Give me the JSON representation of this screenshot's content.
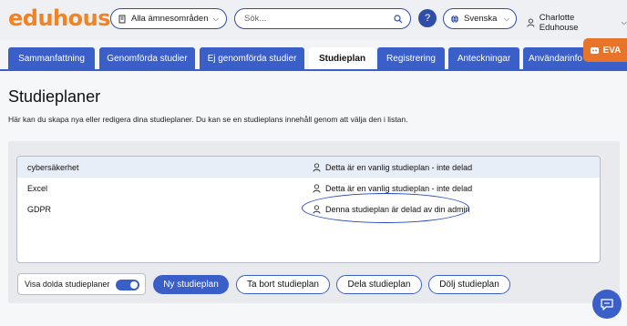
{
  "header": {
    "logo": "eduhouse",
    "subject_select": "Alla ämnesområden",
    "search_placeholder": "Sök...",
    "help": "?",
    "language": "Svenska",
    "user_name": "Charlotte Eduhouse"
  },
  "tabs": [
    {
      "label": "Sammanfattning"
    },
    {
      "label": "Genomförda studier"
    },
    {
      "label": "Ej genomförda studier"
    },
    {
      "label": "Studieplan",
      "active": true
    },
    {
      "label": "Registrering"
    },
    {
      "label": "Anteckningar"
    },
    {
      "label": "Användarinfo"
    }
  ],
  "eva": {
    "label": "EVA"
  },
  "page": {
    "title": "Studieplaner",
    "intro": "Här kan du skapa nya eller redigera dina studieplaner. Du kan se en studieplans innehåll genom att välja den i listan."
  },
  "plans": [
    {
      "name": "cybersäkerhet",
      "status": "Detta är en vanlig studieplan - inte delad",
      "selected": true
    },
    {
      "name": "Excel",
      "status": "Detta är en vanlig studieplan - inte delad"
    },
    {
      "name": "GDPR",
      "status": "Denna studieplan är delad av din admin"
    }
  ],
  "controls": {
    "show_hidden": "Visa dolda studieplaner",
    "new_plan": "Ny studieplan",
    "delete_plan": "Ta bort studieplan",
    "share_plan": "Dela studieplan",
    "hide_plan": "Dölj studieplan"
  },
  "colors": {
    "accent": "#3b5fc9",
    "brand": "#f58220",
    "eva": "#e8742a"
  }
}
